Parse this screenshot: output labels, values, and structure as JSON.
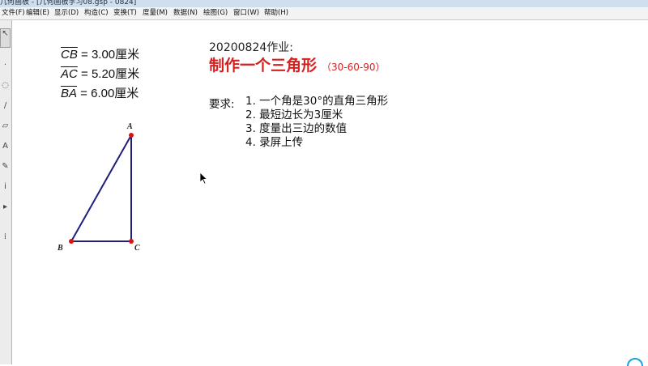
{
  "window": {
    "title": "几何画板 - [几何画板学习08.gsp - 0824]"
  },
  "menu": [
    "文件(F)",
    "编辑(E)",
    "显示(D)",
    "构造(C)",
    "变换(T)",
    "度量(M)",
    "数据(N)",
    "绘图(G)",
    "窗口(W)",
    "帮助(H)"
  ],
  "measurements": [
    {
      "segment": "CB",
      "rest": " = 3.00厘米"
    },
    {
      "segment": "AC",
      "rest": " = 5.20厘米"
    },
    {
      "segment": "BA",
      "rest": " = 6.00厘米"
    }
  ],
  "homework": {
    "date_label": "20200824作业:",
    "heading": "制作一个三角形",
    "heading_note": "（30-60-90）",
    "req_label": "要求:",
    "requirements": [
      "1. 一个角是30°的直角三角形",
      "2. 最短边长为3厘米",
      "3. 度量出三边的数值",
      "4. 录屏上传"
    ]
  },
  "triangle": {
    "labels": {
      "A": "A",
      "B": "B",
      "C": "C"
    },
    "stroke": "#1f1f7a",
    "point_color": "#d11"
  },
  "colors": {
    "heading": "#d62020"
  }
}
